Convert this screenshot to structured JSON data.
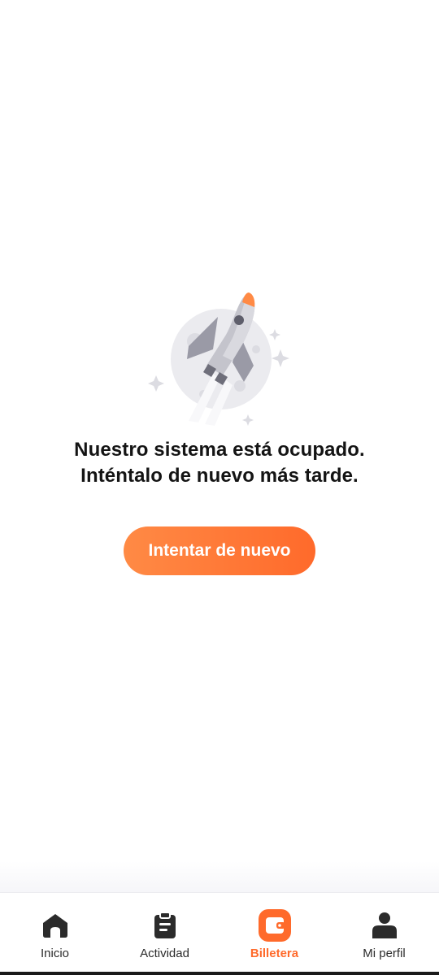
{
  "error": {
    "line1": "Nuestro sistema está ocupado.",
    "line2": "Inténtalo de nuevo más tarde.",
    "retry_label": "Intentar de nuevo"
  },
  "tabs": [
    {
      "label": "Inicio",
      "icon": "home-icon",
      "active": false
    },
    {
      "label": "Actividad",
      "icon": "clipboard-icon",
      "active": false
    },
    {
      "label": "Billetera",
      "icon": "wallet-icon",
      "active": true
    },
    {
      "label": "Mi perfil",
      "icon": "profile-icon",
      "active": false
    }
  ],
  "colors": {
    "accent": "#ff6a2b",
    "text": "#141414",
    "icon_dark": "#2b2b2b"
  }
}
